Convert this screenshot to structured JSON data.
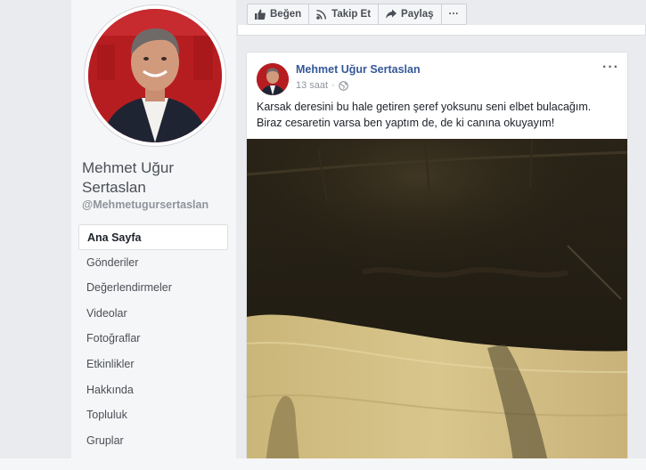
{
  "profile": {
    "name": "Mehmet Uğur Sertaslan",
    "handle": "@Mehmetugursertaslan"
  },
  "nav": {
    "items": [
      {
        "label": "Ana Sayfa",
        "active": true
      },
      {
        "label": "Gönderiler"
      },
      {
        "label": "Değerlendirmeler"
      },
      {
        "label": "Videolar"
      },
      {
        "label": "Fotoğraflar"
      },
      {
        "label": "Etkinlikler"
      },
      {
        "label": "Hakkında"
      },
      {
        "label": "Topluluk"
      },
      {
        "label": "Gruplar"
      }
    ]
  },
  "actions": {
    "like": "Beğen",
    "follow": "Takip Et",
    "share": "Paylaş",
    "more": "···"
  },
  "post": {
    "author": "Mehmet Uğur Sertaslan",
    "time": "13 saat",
    "separator": "·",
    "more": "···",
    "text_line1": "Karsak deresini bu hale getiren şeref yoksunu seni elbet bulacağım.",
    "text_line2": "Biraz cesaretin varsa ben yaptım de, de ki canına okuyayım!"
  },
  "colors": {
    "link_blue": "#365899",
    "page_bg": "#e9ebee",
    "avatar_red": "#b3191d"
  },
  "icons": {
    "like": "thumbs-up-icon",
    "follow": "rss-icon",
    "share": "share-arrow-icon",
    "audience": "globe-icon"
  }
}
